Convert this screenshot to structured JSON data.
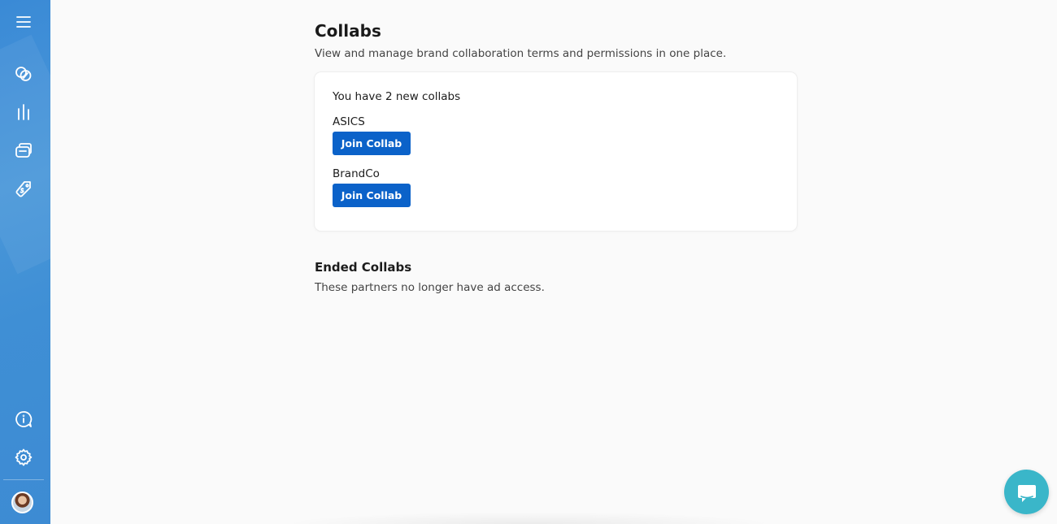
{
  "sidebar": {
    "top_items": [
      {
        "icon": "menu-icon",
        "label": ""
      },
      {
        "icon": "collabs-icon",
        "label": ""
      },
      {
        "icon": "analytics-icon",
        "label": ""
      },
      {
        "icon": "content-icon",
        "label": ""
      },
      {
        "icon": "offers-tag-icon",
        "label": ""
      }
    ],
    "bottom_items": [
      {
        "icon": "info-icon"
      },
      {
        "icon": "gear-icon"
      }
    ],
    "avatar": "user-avatar",
    "accent_color": "#3f8fd5"
  },
  "main": {
    "title": "Collabs",
    "subtitle": "View and manage brand collaboration terms and permissions in one place.",
    "new_collabs": {
      "header": "You have 2 new collabs",
      "items": [
        {
          "brand": "ASICS",
          "button_label": "Join Collab"
        },
        {
          "brand": "BrandCo",
          "button_label": "Join Collab"
        }
      ]
    },
    "ended": {
      "title": "Ended Collabs",
      "description": "These partners no longer have ad access."
    }
  },
  "colors": {
    "primary_button": "#0b62c9",
    "chat_button": "#3ab6c9",
    "background": "#fafafa"
  },
  "chat": {
    "icon": "chat-bubble-icon"
  }
}
